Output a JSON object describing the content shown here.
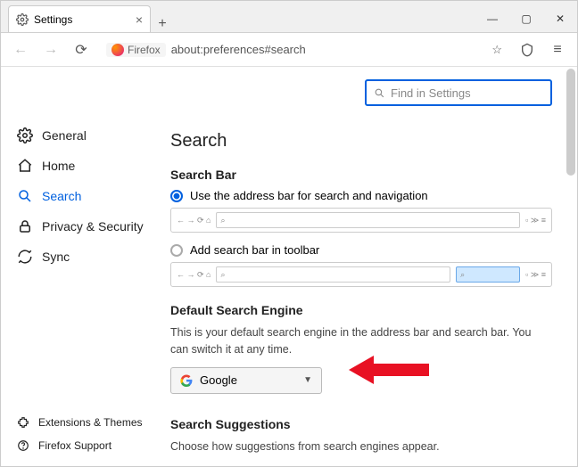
{
  "tab": {
    "title": "Settings"
  },
  "url": {
    "badge": "Firefox",
    "path": "about:preferences#search"
  },
  "find": {
    "placeholder": "Find in Settings"
  },
  "sidebar": {
    "items": [
      {
        "label": "General"
      },
      {
        "label": "Home"
      },
      {
        "label": "Search"
      },
      {
        "label": "Privacy & Security"
      },
      {
        "label": "Sync"
      }
    ],
    "bottom": [
      {
        "label": "Extensions & Themes"
      },
      {
        "label": "Firefox Support"
      }
    ]
  },
  "page": {
    "heading": "Search",
    "searchbar": {
      "title": "Search Bar",
      "opt1": "Use the address bar for search and navigation",
      "opt2": "Add search bar in toolbar"
    },
    "engine": {
      "title": "Default Search Engine",
      "desc": "This is your default search engine in the address bar and search bar. You can switch it at any time.",
      "selected": "Google"
    },
    "suggestions": {
      "title": "Search Suggestions",
      "desc": "Choose how suggestions from search engines appear."
    }
  }
}
